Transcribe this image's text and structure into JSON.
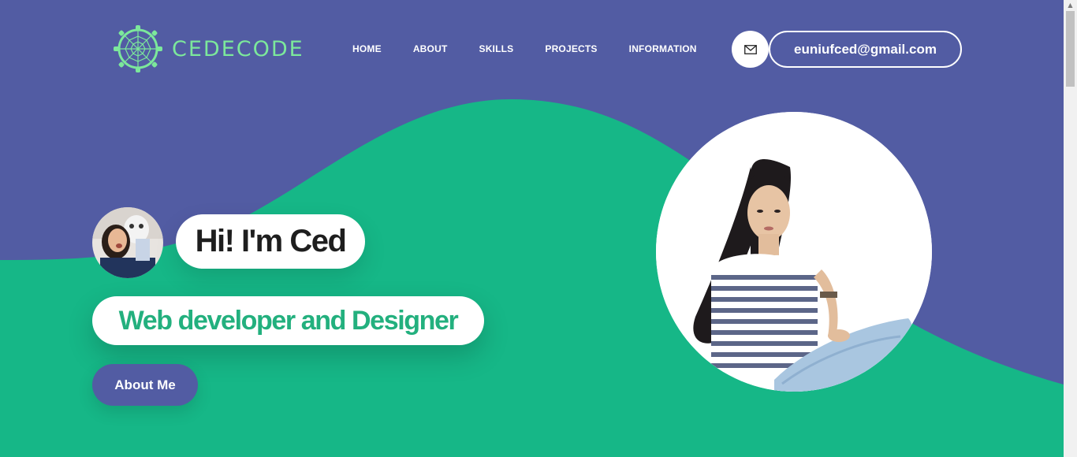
{
  "brand": {
    "name": "CEDECODE",
    "logo_icon": "spider-web-wheel-icon"
  },
  "nav": {
    "items": [
      {
        "label": "HOME"
      },
      {
        "label": "ABOUT"
      },
      {
        "label": "SKILLS"
      },
      {
        "label": "PROJECTS"
      },
      {
        "label": "INFORMATION"
      }
    ]
  },
  "contact": {
    "mail_icon": "envelope-icon",
    "email": "euniufced@gmail.com"
  },
  "hero": {
    "greeting": "Hi! I'm Ced",
    "role": "Web developer and Designer",
    "cta_label": "About Me"
  },
  "colors": {
    "primary_purple": "#525ca3",
    "accent_green": "#16b787",
    "logo_green": "#7ce89b",
    "white": "#ffffff"
  }
}
